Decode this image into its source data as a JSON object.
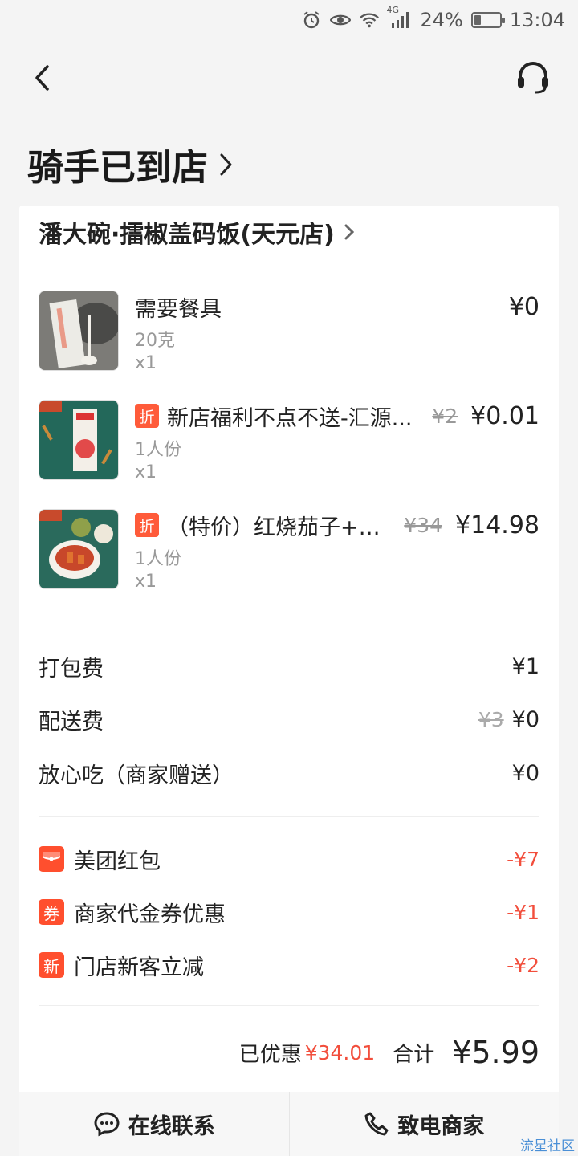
{
  "status_bar": {
    "network": "4G",
    "battery": "24%",
    "battery_level": 0.24,
    "time": "13:04",
    "icons": [
      "alarm-icon",
      "eye-icon",
      "wifi-icon",
      "signal-icon",
      "battery-icon"
    ]
  },
  "nav": {
    "back_icon": "chevron-left-icon",
    "service_icon": "headset-icon"
  },
  "order_status": {
    "title": "骑手已到店"
  },
  "shop": {
    "name": "潘大碗·擂椒盖码饭(天元店)"
  },
  "items": [
    {
      "name": "需要餐具",
      "spec": "20克",
      "qty": "x1",
      "old_price": "",
      "price": "¥0",
      "discount_tag": ""
    },
    {
      "name": "新店福利不点不送-汇源...",
      "spec": "1人份",
      "qty": "x1",
      "old_price": "¥2",
      "price": "¥0.01",
      "discount_tag": "折"
    },
    {
      "name": "（特价）红烧茄子+擂...",
      "spec": "1人份",
      "qty": "x1",
      "old_price": "¥34",
      "price": "¥14.98",
      "discount_tag": "折"
    }
  ],
  "fees": [
    {
      "label": "打包费",
      "old": "",
      "value": "¥1"
    },
    {
      "label": "配送费",
      "old": "¥3",
      "value": "¥0"
    },
    {
      "label": "放心吃（商家赠送）",
      "old": "",
      "value": "¥0"
    }
  ],
  "discounts": [
    {
      "badge": "",
      "label": "美团红包",
      "value": "-¥7"
    },
    {
      "badge": "券",
      "label": "商家代金券优惠",
      "value": "-¥1"
    },
    {
      "badge": "新",
      "label": "门店新客立减",
      "value": "-¥2"
    }
  ],
  "summary": {
    "saved_label": "已优惠",
    "saved_value": "¥34.01",
    "total_label": "合计",
    "total_value": "¥5.99"
  },
  "actions": {
    "chat_label": "在线联系",
    "call_label": "致电商家"
  },
  "watermark": "流星社区",
  "colors": {
    "accent": "#f24e3c",
    "badge": "#ff4f2e",
    "background": "#f4f4f4"
  }
}
